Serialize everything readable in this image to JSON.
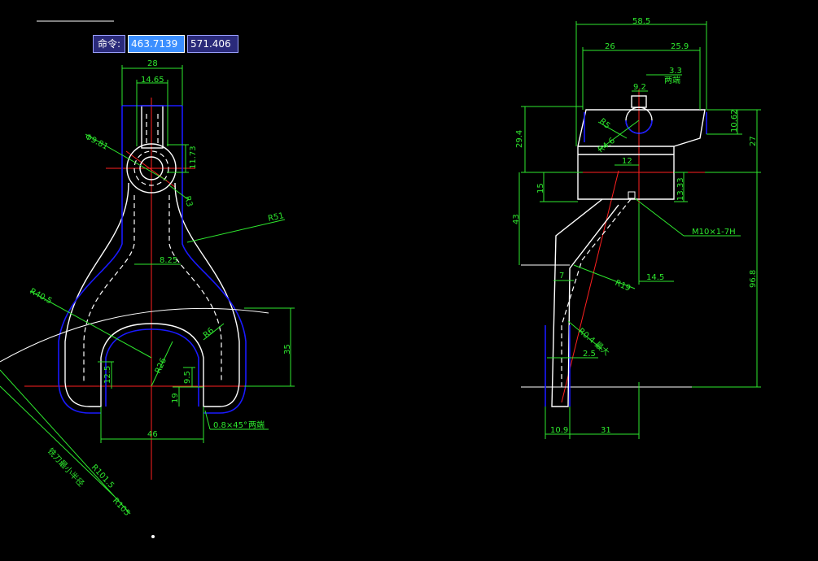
{
  "command_bar": {
    "label": "命令:",
    "x_value": "463.7139",
    "y_value": "571.406"
  },
  "left_view": {
    "dims": {
      "w28": "28",
      "w1465": "14.65",
      "phi981": "Φ9.81",
      "h1173": "11.73",
      "r3": "R3",
      "r51": "R51",
      "w825": "8.25",
      "r405": "R40.5",
      "r6": "R6",
      "h35": "35",
      "r26": "R26",
      "h125": "12.5",
      "h95": "9.5",
      "h19": "19",
      "w46": "46",
      "chamfer": "0.8×45°",
      "chamfer_note": "两端",
      "r1015": "R101.5",
      "r105": "R105",
      "cutter_note": "铣刀最小半径"
    }
  },
  "right_view": {
    "dims": {
      "w585": "58.5",
      "w26": "26",
      "w259": "25.9",
      "w33": "3.3",
      "both_ends": "两端",
      "w92": "9.2",
      "r5": "R5",
      "r46": "R4.6",
      "h1062": "10.62",
      "h27": "27",
      "h294": "29.4",
      "w12": "12",
      "h15": "15",
      "h1333": "13.33",
      "thread": "M10×1-7H",
      "h43": "43",
      "w145": "14.5",
      "r19": "R19",
      "h968": "96.8",
      "w7": "7",
      "r04": "R0.4 最大",
      "w25": "2.5",
      "w109": "10.9",
      "w31": "31"
    }
  },
  "colors": {
    "background": "#000000",
    "dimension": "#2ee82e",
    "outline": "#ffffff",
    "hidden_blue": "#1a1aff",
    "centerline": "#ff2020"
  }
}
